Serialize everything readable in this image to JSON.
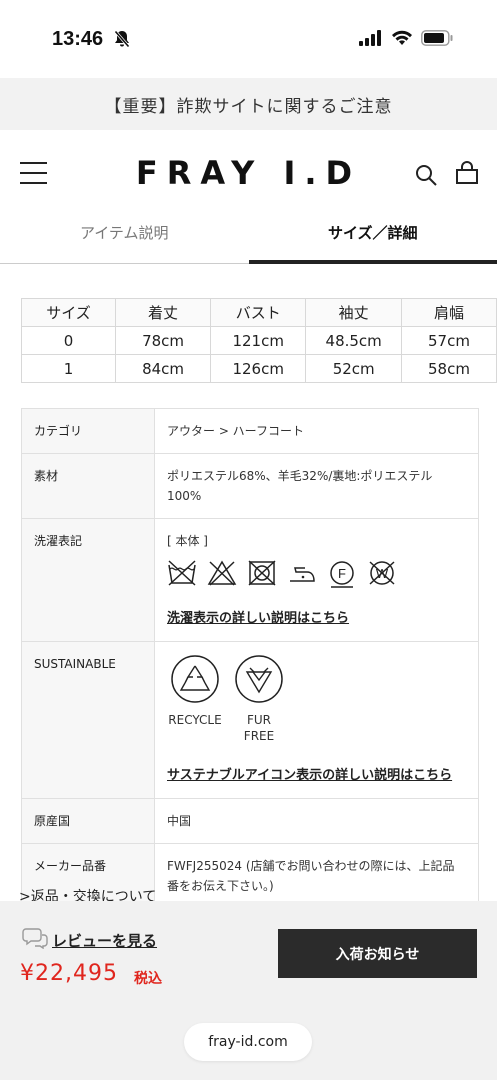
{
  "status": {
    "time": "13:46"
  },
  "notice": {
    "text": "【重要】詐欺サイトに関するご注意"
  },
  "header": {
    "logo": "FRAY I.D"
  },
  "tabs": [
    {
      "label": "アイテム説明",
      "active": false
    },
    {
      "label": "サイズ／詳細",
      "active": true
    }
  ],
  "size_table": {
    "headers": [
      "サイズ",
      "着丈",
      "バスト",
      "袖丈",
      "肩幅"
    ],
    "rows": [
      [
        "0",
        "78cm",
        "121cm",
        "48.5cm",
        "57cm"
      ],
      [
        "1",
        "84cm",
        "126cm",
        "52cm",
        "58cm"
      ]
    ]
  },
  "details": {
    "category_label": "カテゴリ",
    "category_value": "アウター > ハーフコート",
    "material_label": "素材",
    "material_value": "ポリエステル68%、羊毛32%/裏地:ポリエステル100%",
    "care_label": "洗濯表記",
    "care_section": "[ 本体 ]",
    "care_icons": [
      "no-wash-icon",
      "no-bleach-icon",
      "no-tumble-dry-icon",
      "iron-low-icon",
      "dry-clean-f-icon",
      "no-wet-clean-icon"
    ],
    "care_link": "洗濯表示の詳しい説明はこちら",
    "sustainable_label": "SUSTAINABLE",
    "sustainable_items": [
      "RECYCLE",
      "FUR FREE"
    ],
    "sustainable_link": "サステナブルアイコン表示の詳しい説明はこちら",
    "origin_label": "原産国",
    "origin_value": "中国",
    "maker_label": "メーカー品番",
    "maker_value": "FWFJ255024 (店舗でお問い合わせの際には、上記品番をお伝え下さい。)"
  },
  "returns_link": ">返品・交換について",
  "bottom": {
    "review": "レビューを見る",
    "price": "¥22,495",
    "tax": "税込",
    "notify_button": "入荷お知らせ",
    "url": "fray-id.com"
  },
  "colors": {
    "price": "#e0261e",
    "button": "#2b2b2b",
    "notice_bg": "#f2f2f2"
  }
}
